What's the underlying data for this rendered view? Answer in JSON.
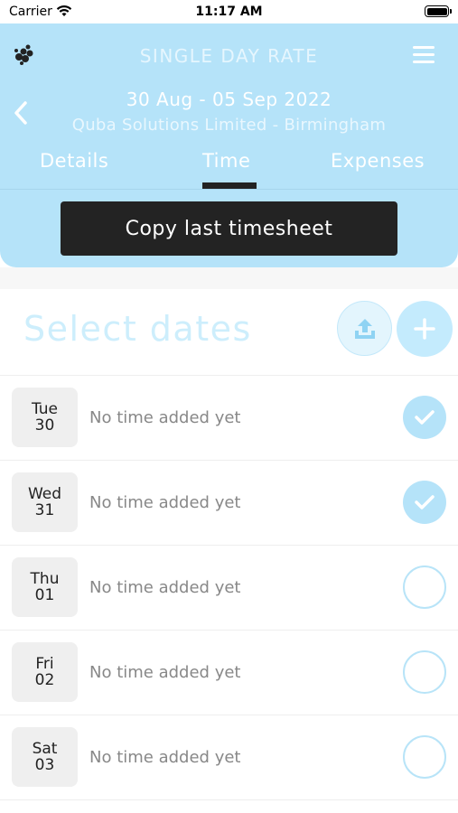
{
  "status_bar": {
    "carrier": "Carrier",
    "time": "11:17 AM"
  },
  "header": {
    "title": "SINGLE DAY RATE",
    "dates": "30 Aug - 05 Sep 2022",
    "client": "Quba Solutions Limited - Birmingham",
    "tabs": [
      {
        "label": "Details"
      },
      {
        "label": "Time",
        "active": true
      },
      {
        "label": "Expenses"
      }
    ],
    "copy_button": "Copy last timesheet",
    "background": "#b5e3f9"
  },
  "select": {
    "title": "Select dates"
  },
  "days": [
    {
      "weekday": "Tue",
      "date": "30",
      "status": "No time added yet",
      "checked": true
    },
    {
      "weekday": "Wed",
      "date": "31",
      "status": "No time added yet",
      "checked": true
    },
    {
      "weekday": "Thu",
      "date": "01",
      "status": "No time added yet",
      "checked": false
    },
    {
      "weekday": "Fri",
      "date": "02",
      "status": "No time added yet",
      "checked": false
    },
    {
      "weekday": "Sat",
      "date": "03",
      "status": "No time added yet",
      "checked": false
    }
  ],
  "icons": {
    "logo": "logo-icon",
    "menu": "menu-icon",
    "back": "chevron-left-icon",
    "upload": "upload-icon",
    "add": "plus-icon",
    "check": "check-icon"
  },
  "colors": {
    "accent": "#b5e3f9",
    "dark": "#232323"
  }
}
